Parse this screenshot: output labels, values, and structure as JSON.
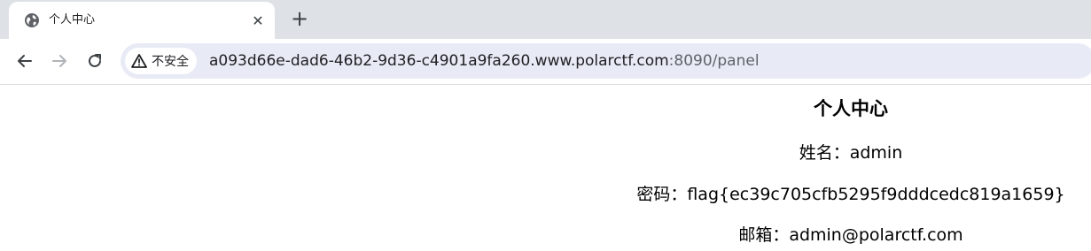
{
  "tab": {
    "title": "个人中心",
    "close_glyph": "✕",
    "icon": "globe-icon"
  },
  "new_tab_glyph": "+",
  "toolbar": {
    "back_icon": "back-arrow-icon",
    "forward_icon": "forward-arrow-icon",
    "reload_icon": "reload-icon"
  },
  "omnibox": {
    "security_label": "不安全",
    "url_host": "a093d66e-dad6-46b2-9d36-c4901a9fa260.www.polarctf.com",
    "url_rest": ":8090/panel"
  },
  "page": {
    "heading": "个人中心",
    "name_line": "姓名：admin",
    "password_line": "密码：flag{ec39c705cfb5295f9dddcedc819a1659}",
    "email_line": "邮箱：admin@polarctf.com"
  },
  "colors": {
    "tabstrip_bg": "#dee1e6",
    "omnibox_bg": "#e8eaf5",
    "text": "#202124"
  }
}
